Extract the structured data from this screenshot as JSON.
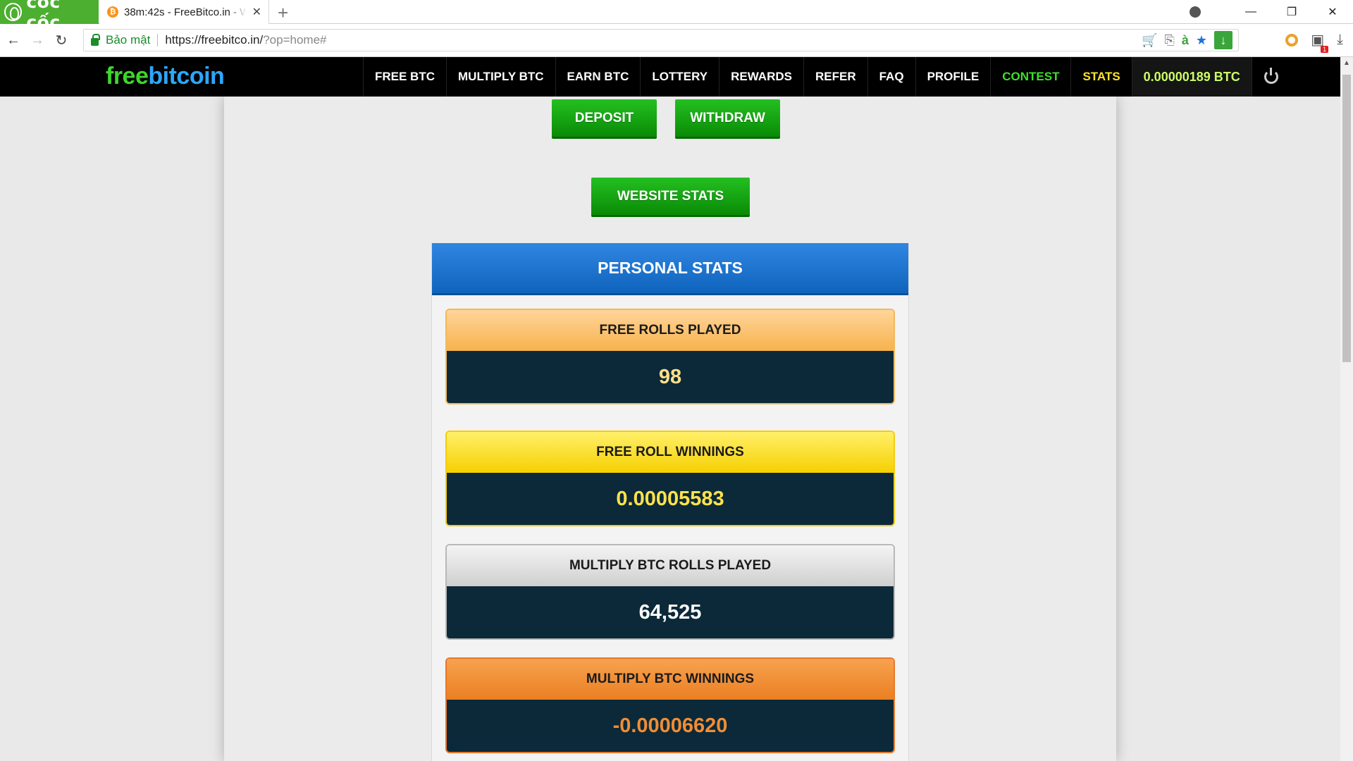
{
  "browser": {
    "brand": "cốc cốc",
    "tab_title": "38m:42s - FreeBitco.in - W",
    "tab_favicon": "₿",
    "secure_label": "Bảo mật",
    "url_host": "https://freebitco.in/",
    "url_path": "?op=home#",
    "ext_badge": "1"
  },
  "site": {
    "logo_free": "free",
    "logo_bitcoin": "bitcoin",
    "menu": [
      {
        "label": "FREE BTC"
      },
      {
        "label": "MULTIPLY BTC"
      },
      {
        "label": "EARN BTC"
      },
      {
        "label": "LOTTERY"
      },
      {
        "label": "REWARDS"
      },
      {
        "label": "REFER"
      },
      {
        "label": "FAQ"
      },
      {
        "label": "PROFILE"
      },
      {
        "label": "CONTEST"
      },
      {
        "label": "STATS"
      }
    ],
    "balance": "0.00000189 BTC"
  },
  "buttons": {
    "deposit": "DEPOSIT",
    "withdraw": "WITHDRAW",
    "website_stats": "WEBSITE STATS"
  },
  "personal_stats": {
    "title": "PERSONAL STATS",
    "items": [
      {
        "label": "FREE ROLLS PLAYED",
        "value": "98"
      },
      {
        "label": "FREE ROLL WINNINGS",
        "value": "0.00005583"
      },
      {
        "label": "MULTIPLY BTC ROLLS PLAYED",
        "value": "64,525"
      },
      {
        "label": "MULTIPLY BTC WINNINGS",
        "value": "-0.00006620"
      }
    ]
  },
  "colors": {
    "nav_bg": "#000000",
    "contest": "#3ee02a",
    "stats": "#ffe22a",
    "balance": "#ccff66",
    "panel_header": "#1a73d0",
    "value_bg": "#0b2938"
  }
}
